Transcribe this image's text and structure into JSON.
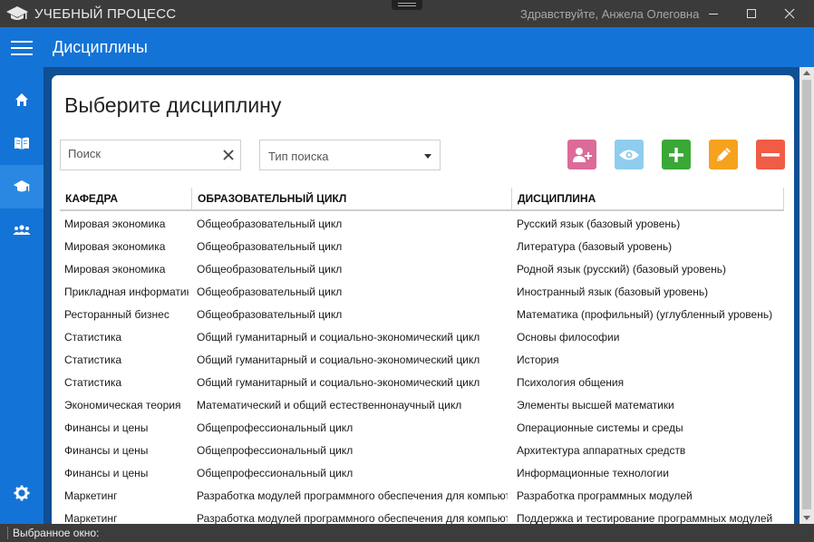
{
  "window": {
    "title": "УЧЕБНЫЙ ПРОЦЕСС",
    "greeting": "Здравствуйте, Анжела Олеговна"
  },
  "header": {
    "title": "Дисциплины"
  },
  "sidebar": {
    "items": [
      {
        "name": "home",
        "icon": "home-icon"
      },
      {
        "name": "book",
        "icon": "book-icon"
      },
      {
        "name": "graduation",
        "icon": "graduation-cap-icon",
        "active": true
      },
      {
        "name": "people",
        "icon": "people-icon"
      },
      {
        "name": "settings",
        "icon": "gear-icon"
      }
    ]
  },
  "main": {
    "title": "Выберите дисциплину",
    "search_placeholder": "Поиск",
    "search_type_placeholder": "Тип поиска",
    "actions": [
      {
        "name": "assign-user",
        "icon": "add-user-icon",
        "color": "#dd6b9a"
      },
      {
        "name": "view",
        "icon": "eye-icon",
        "color": "#8fcdef"
      },
      {
        "name": "add",
        "icon": "plus-icon",
        "color": "#3aa836"
      },
      {
        "name": "edit",
        "icon": "pencil-icon",
        "color": "#f5a21e"
      },
      {
        "name": "delete",
        "icon": "minus-icon",
        "color": "#f05c45"
      }
    ]
  },
  "table": {
    "headers": [
      "КАФЕДРА",
      "ОБРАЗОВАТЕЛЬНЫЙ ЦИКЛ",
      "ДИСЦИПЛИНА"
    ],
    "rows": [
      [
        "Мировая экономика",
        "Общеобразовательный цикл",
        "Русский язык (базовый уровень)"
      ],
      [
        "Мировая экономика",
        "Общеобразовательный цикл",
        "Литература (базовый уровень)"
      ],
      [
        "Мировая экономика",
        "Общеобразовательный цикл",
        "Родной язык (русский) (базовый уровень)"
      ],
      [
        "Прикладная информатика",
        "Общеобразовательный цикл",
        "Иностранный язык (базовый уровень)"
      ],
      [
        "Ресторанный бизнес",
        "Общеобразовательный цикл",
        "Математика (профильный) (углубленный уровень)"
      ],
      [
        "Статистика",
        "Общий гуманитарный и социально-экономический цикл",
        "Основы философии"
      ],
      [
        "Статистика",
        "Общий гуманитарный и социально-экономический цикл",
        "История"
      ],
      [
        "Статистика",
        "Общий гуманитарный и социально-экономический цикл",
        "Психология общения"
      ],
      [
        "Экономическая теория",
        "Математический и общий естественнонаучный цикл",
        "Элементы высшей математики"
      ],
      [
        "Финансы и цены",
        "Общепрофессиональный цикл",
        "Операционные системы и среды"
      ],
      [
        "Финансы и цены",
        "Общепрофессиональный цикл",
        "Архитектура аппаратных средств"
      ],
      [
        "Финансы и цены",
        "Общепрофессиональный цикл",
        "Информационные технологии"
      ],
      [
        "Маркетинг",
        "Разработка модулей программного обеспечения для компьютерных систем",
        "Разработка программных модулей"
      ],
      [
        "Маркетинг",
        "Разработка модулей программного обеспечения для компьютерных систем",
        "Поддержка и тестирование программных модулей"
      ]
    ]
  },
  "status": {
    "text": "Выбранное окно:"
  }
}
